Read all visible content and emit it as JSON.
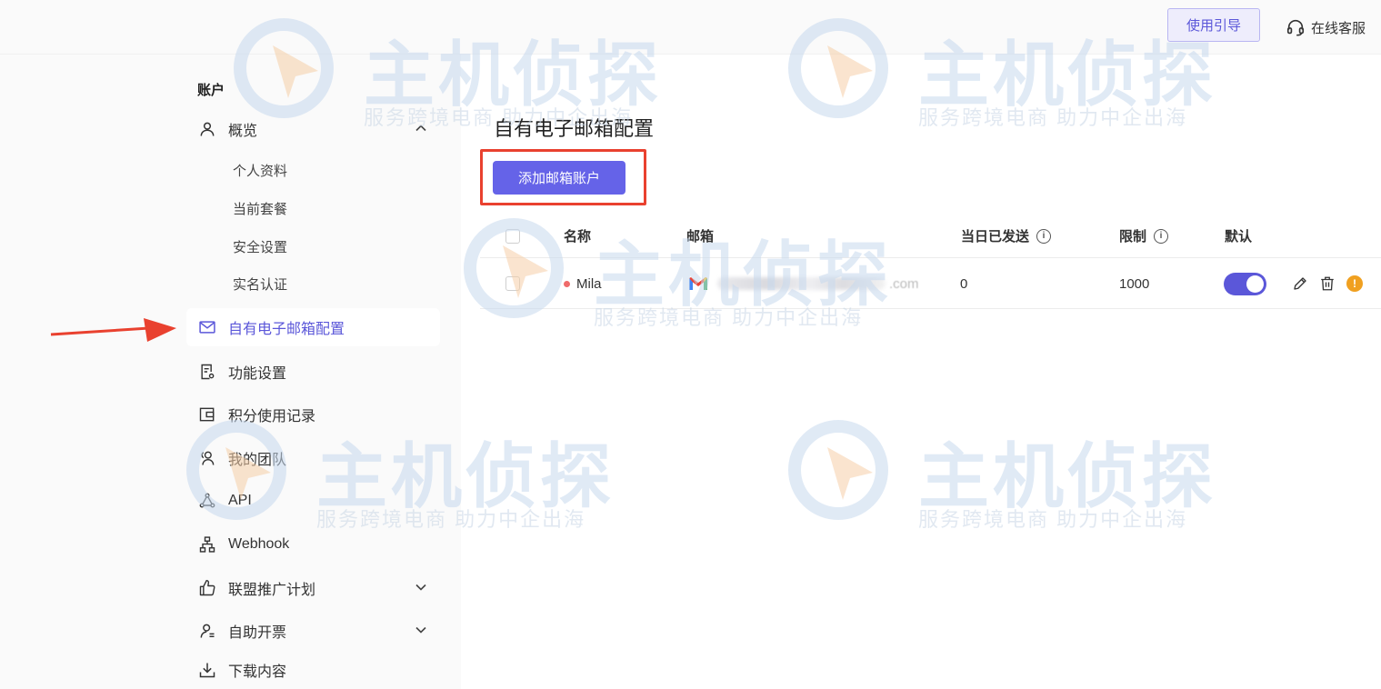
{
  "header": {
    "guide_label": "使用引导",
    "support_label": "在线客服"
  },
  "sidebar": {
    "section_title": "账户",
    "items": [
      {
        "label": "概览",
        "icon": "user-icon",
        "expanded": true
      },
      {
        "label": "自有电子邮箱配置",
        "icon": "mail-icon",
        "active": true
      },
      {
        "label": "功能设置",
        "icon": "settings-doc-icon"
      },
      {
        "label": "积分使用记录",
        "icon": "wallet-icon"
      },
      {
        "label": "我的团队",
        "icon": "team-icon"
      },
      {
        "label": "API",
        "icon": "api-icon"
      },
      {
        "label": "Webhook",
        "icon": "webhook-icon"
      },
      {
        "label": "联盟推广计划",
        "icon": "thumbs-up-icon",
        "expandable": true
      },
      {
        "label": "自助开票",
        "icon": "invoice-user-icon",
        "expandable": true
      },
      {
        "label": "下载内容",
        "icon": "download-icon"
      }
    ],
    "sub_items": [
      "个人资料",
      "当前套餐",
      "安全设置",
      "实名认证"
    ]
  },
  "main": {
    "title": "自有电子邮箱配置",
    "add_button": "添加邮箱账户",
    "table": {
      "columns": [
        "名称",
        "邮箱",
        "当日已发送",
        "限制",
        "默认"
      ],
      "rows": [
        {
          "name": "Mila",
          "email_suffix": ".com",
          "sent_today": "0",
          "limit": "1000",
          "default": true
        }
      ]
    }
  },
  "watermark": {
    "brand": "主机侦探",
    "slogan": "服务跨境电商  助力中企出海"
  },
  "colors": {
    "accent": "#5b57d9",
    "button": "#6563e8",
    "highlight": "#e9412f",
    "status_dot": "#ef6b6b",
    "warning": "#f0a020"
  }
}
